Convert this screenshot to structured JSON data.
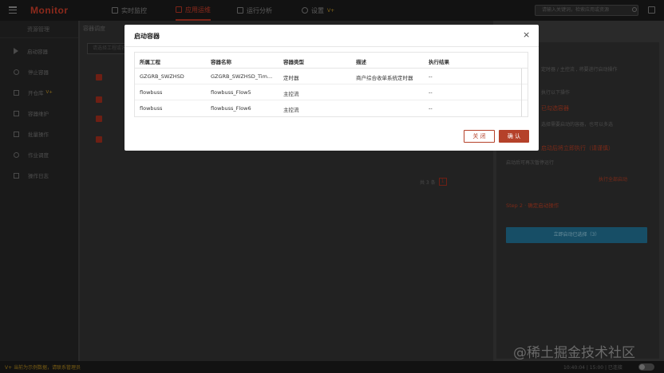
{
  "topbar": {
    "logo": "Monitor",
    "nav": [
      {
        "label": "实时监控"
      },
      {
        "label": "应用运维"
      },
      {
        "label": "运行分析"
      },
      {
        "label": "设置",
        "badge": "V+"
      }
    ],
    "search_placeholder": "请输入关键词，检索应用或资源"
  },
  "sidebar": {
    "title": "资源管理",
    "items": [
      {
        "label": "启动容器"
      },
      {
        "label": "停止容器"
      },
      {
        "label": "开仓库",
        "badge": "V+"
      },
      {
        "label": "容器维护"
      },
      {
        "label": "批量操作"
      },
      {
        "label": "作业调度"
      },
      {
        "label": "操作日志"
      }
    ]
  },
  "main": {
    "tab_label": "容器调度",
    "search_placeholder": "请选择工程或容器",
    "pager": {
      "total_label": "共 3 条",
      "current_page": "1"
    }
  },
  "right_panel": {
    "line1": "定时器 / 主控流 , 将要进行启动操作",
    "line2": "执行以下操作",
    "step1_title": "已勾选容器",
    "step1_desc": "选择需要启动的容器，也可以多选",
    "warning": "启动后将立即执行（请谨慎）",
    "desc2": "启动后可再次暂停运行",
    "link": "执行全部启动",
    "step2_title": "Step 2 · 确定启动操作",
    "button": "立即启动已选择（3）"
  },
  "statusbar": {
    "left": "V+ 当前为示例数据，请联系管理员",
    "right": "10:40:04 | 15:00 | 已连接"
  },
  "modal": {
    "title": "启动容器",
    "columns": [
      "所属工程",
      "容器名称",
      "容器类型",
      "描述",
      "执行结果"
    ],
    "rows": [
      [
        "GZGRB_SWZHSD",
        "GZGRB_SWZHSD_Tim...",
        "定时器",
        "商户综合收单系统定时器",
        "--"
      ],
      [
        "flowbuss",
        "flowbuss_Flow5",
        "主控流",
        "",
        "--"
      ],
      [
        "flowbuss",
        "flowbuss_Flow6",
        "主控流",
        "",
        "--"
      ]
    ],
    "cancel_label": "关 闭",
    "confirm_label": "确 认"
  },
  "watermark": "@稀土掘金技术社区",
  "colors": {
    "accent": "#b5412a",
    "logo": "#8c2a1c",
    "panel_button": "#174e66"
  }
}
